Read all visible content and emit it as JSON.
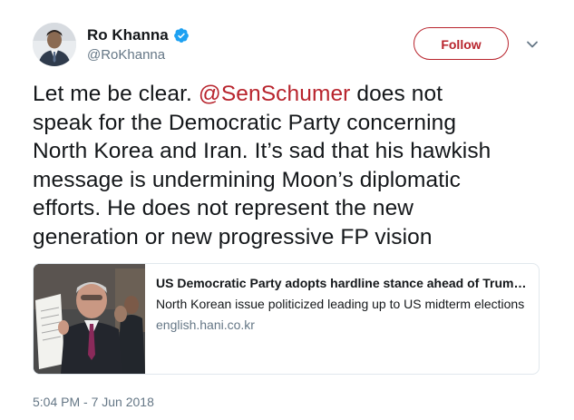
{
  "author": {
    "display_name": "Ro Khanna",
    "handle": "@RoKhanna",
    "verified": true
  },
  "header": {
    "follow_label": "Follow",
    "more_icon": "chevron-down-icon"
  },
  "tweet": {
    "lines": [
      {
        "before": "Let me be clear. ",
        "mention": "@SenSchumer",
        "after": " does not"
      },
      {
        "text": "speak for the Democratic Party concerning"
      },
      {
        "text": "North Korea and Iran. It’s sad that his hawkish"
      },
      {
        "text": "message is undermining Moon’s diplomatic"
      },
      {
        "text": "efforts. He does not represent the new"
      },
      {
        "text": "generation or new progressive FP vision"
      }
    ]
  },
  "card": {
    "title": "US Democratic Party adopts hardline stance ahead of Trump…",
    "description": "North Korean issue politicized leading up to US midterm elections",
    "domain": "english.hani.co.kr"
  },
  "timestamp": "5:04 PM - 7 Jun 2018",
  "colors": {
    "accent": "#b8242d",
    "verified": "#1da1f2",
    "muted": "#657786",
    "text": "#14171a"
  }
}
